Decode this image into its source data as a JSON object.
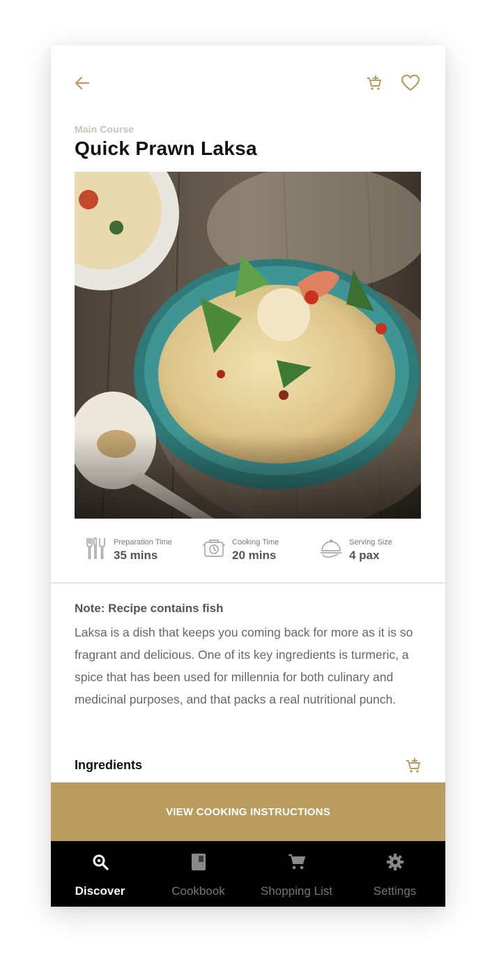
{
  "header": {
    "back_icon": "arrow-left-icon",
    "cart_icon": "cart-add-icon",
    "favorite_icon": "heart-icon",
    "accent": "#b99c5e"
  },
  "recipe": {
    "category": "Main Course",
    "title": "Quick Prawn Laksa"
  },
  "stats": [
    {
      "icon": "utensils-icon",
      "label": "Preparation Time",
      "value": "35 mins"
    },
    {
      "icon": "pot-timer-icon",
      "label": "Cooking Time",
      "value": "20 mins"
    },
    {
      "icon": "serving-dish-icon",
      "label": "Serving Size",
      "value": "4 pax"
    }
  ],
  "note": {
    "title": "Note: Recipe contains fish",
    "description": "Laksa is a dish that keeps you coming back for more as it is so fragrant and delicious. One of its key ingredients is turmeric, a spice that has been used for millennia for both culinary and medicinal purposes, and that packs a real nutritional punch."
  },
  "ingredients": {
    "title": "Ingredients"
  },
  "cta": {
    "label": "VIEW COOKING INSTRUCTIONS",
    "color": "#b99c5e"
  },
  "tabbar": {
    "tabs": [
      {
        "label": "Discover",
        "icon": "search-icon",
        "active": true
      },
      {
        "label": "Cookbook",
        "icon": "book-icon",
        "active": false
      },
      {
        "label": "Shopping List",
        "icon": "cart-icon",
        "active": false
      },
      {
        "label": "Settings",
        "icon": "gear-icon",
        "active": false
      }
    ]
  }
}
